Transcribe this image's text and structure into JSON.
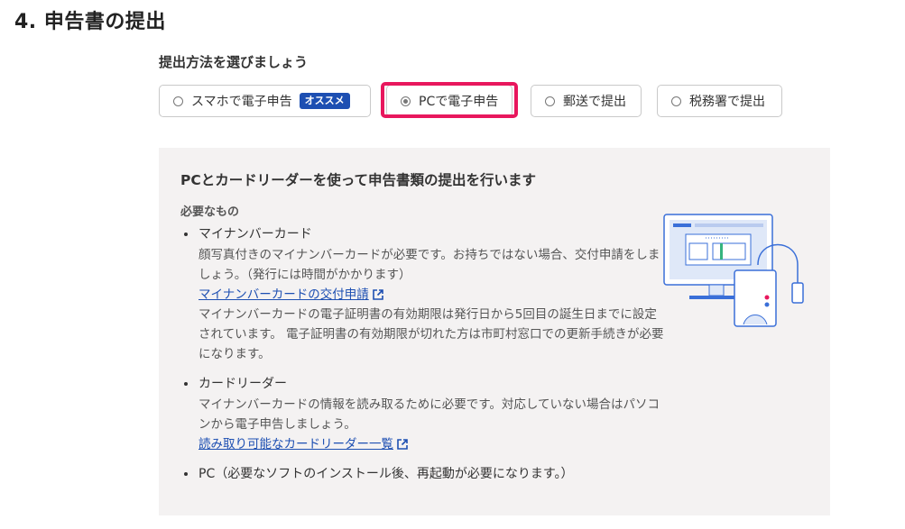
{
  "section": {
    "title": "4. 申告書の提出"
  },
  "method": {
    "heading": "提出方法を選びましょう",
    "options": [
      {
        "label": "スマホで電子申告",
        "badge": "オススメ",
        "selected": false
      },
      {
        "label": "PCで電子申告",
        "selected": true
      },
      {
        "label": "郵送で提出",
        "selected": false
      },
      {
        "label": "税務署で提出",
        "selected": false
      }
    ]
  },
  "panel": {
    "title": "PCとカードリーダーを使って申告書類の提出を行います",
    "needs_label": "必要なもの",
    "items": [
      {
        "name": "マイナンバーカード",
        "desc1": "顔写真付きのマイナンバーカードが必要です。お持ちではない場合、交付申請をしましょう。（発行には時間がかかります）",
        "link": "マイナンバーカードの交付申請",
        "desc2": "マイナンバーカードの電子証明書の有効期限は発行日から5回目の誕生日までに設定されています。 電子証明書の有効期限が切れた方は市町村窓口での更新手続きが必要になります。"
      },
      {
        "name": "カードリーダー",
        "desc1": "マイナンバーカードの情報を読み取るために必要です。対応していない場合はパソコンから電子申告しましょう。",
        "link": "読み取り可能なカードリーダー一覧"
      },
      {
        "name": "PC（必要なソフトのインストール後、再起動が必要になります。）"
      }
    ]
  },
  "colors": {
    "accent_blue": "#1d4fb2",
    "highlight_pink": "#e8175d",
    "panel_bg": "#f4f2f2"
  },
  "icons": [
    "radio-icon",
    "external-link-icon",
    "pc-card-reader-illustration"
  ]
}
